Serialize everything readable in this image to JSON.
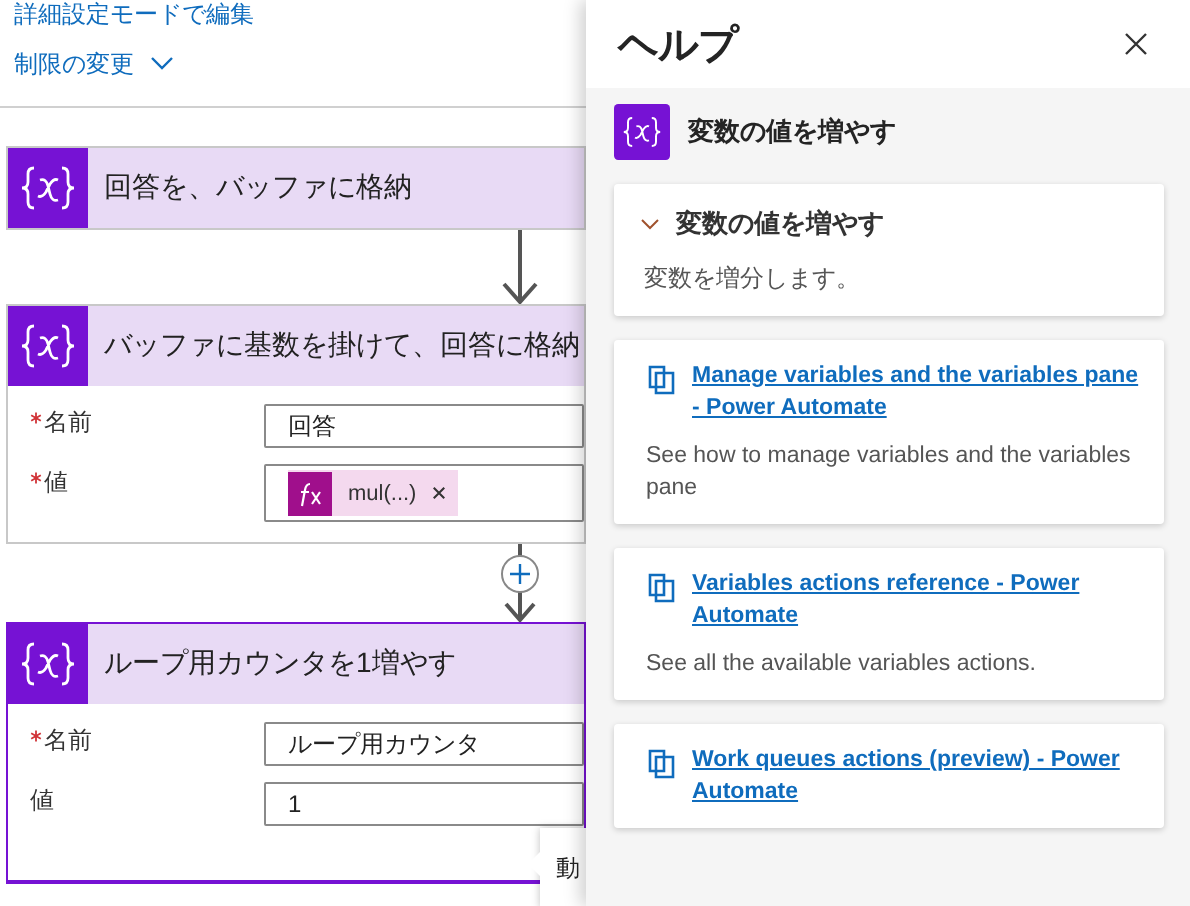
{
  "advanced_mode_link": "詳細設定モードで編集",
  "limits_menu": {
    "label": "制限の変更"
  },
  "actions": [
    {
      "title": "回答を、バッファに格納",
      "expanded": false,
      "selected": false
    },
    {
      "title": "バッファに基数を掛けて、回答に格納",
      "expanded": true,
      "selected": false,
      "fields": [
        {
          "label": "名前",
          "required": true,
          "kind": "text",
          "value": "回答"
        },
        {
          "label": "値",
          "required": true,
          "kind": "token",
          "value": "mul(...)"
        }
      ]
    },
    {
      "title": "ループ用カウンタを1増やす",
      "expanded": true,
      "selected": true,
      "fields": [
        {
          "label": "名前",
          "required": true,
          "kind": "text",
          "value": "ループ用カウンタ"
        },
        {
          "label": "値",
          "required": false,
          "kind": "text",
          "value": "1"
        }
      ]
    }
  ],
  "connectors": [
    {
      "kind": "arrow"
    },
    {
      "kind": "add"
    }
  ],
  "tooltip": {
    "text": "動"
  },
  "help": {
    "title": "ヘルプ",
    "action": "変数の値を増やす",
    "summary": {
      "heading": "変数の値を増やす",
      "expanded": true,
      "text": "変数を増分します。"
    },
    "links": [
      {
        "title": "Manage variables and the variables pane - Power Automate",
        "description": "See how to manage variables and the variables pane"
      },
      {
        "title": "Variables actions reference - Power Automate",
        "description": "See all the available variables actions."
      },
      {
        "title": "Work queues actions (preview) - Power Automate"
      }
    ]
  }
}
